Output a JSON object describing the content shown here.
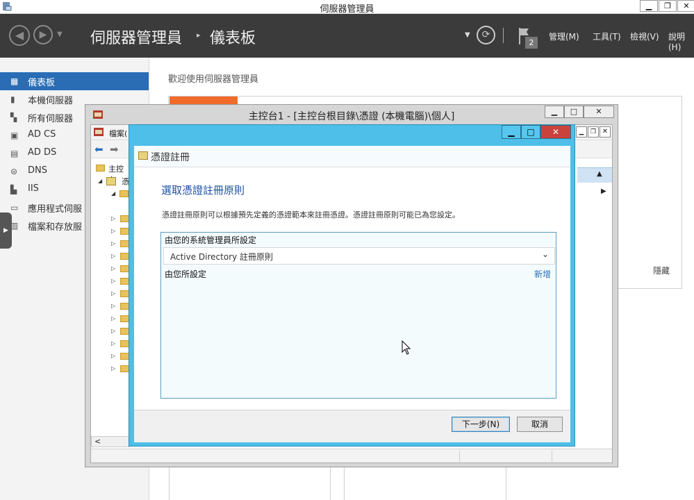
{
  "server_manager": {
    "window_title": "伺服器管理員",
    "breadcrumb": {
      "root": "伺服器管理員",
      "current": "儀表板"
    },
    "notification_count": "2",
    "menus": [
      "管理(M)",
      "工具(T)",
      "檢視(V)",
      "說明(H)"
    ],
    "nav_items": [
      "儀表板",
      "本機伺服器",
      "所有伺服器",
      "AD CS",
      "AD DS",
      "DNS",
      "IIS",
      "應用程式伺服",
      "檔案和存放服"
    ],
    "welcome": "歡迎使用伺服器管理員",
    "hide_label": "隱藏"
  },
  "mmc": {
    "window_title": "主控台1 - [主控台根目錄\\憑證 (本機電腦)\\個人]",
    "menu_file": "檔案(",
    "tree_root": "主控台",
    "tree_child": "憑"
  },
  "dialog": {
    "title": "憑證註冊",
    "heading": "選取憑證註冊原則",
    "description": "憑證註冊原則可以根據預先定義的憑證範本來註冊憑證。憑證註冊原則可能已為您設定。",
    "section_admin": "由您的系統管理員所設定",
    "policy_item": "Active Directory 註冊原則",
    "section_user": "由您所設定",
    "add_link": "新增",
    "next_button": "下一步(N)",
    "cancel_button": "取消"
  },
  "colors": {
    "accent_blue": "#2a6db5",
    "dialog_frame": "#4dbfe8",
    "close_red": "#c9433c",
    "header_dark": "#3b3b3b",
    "orange_tile": "#f06b2a"
  }
}
